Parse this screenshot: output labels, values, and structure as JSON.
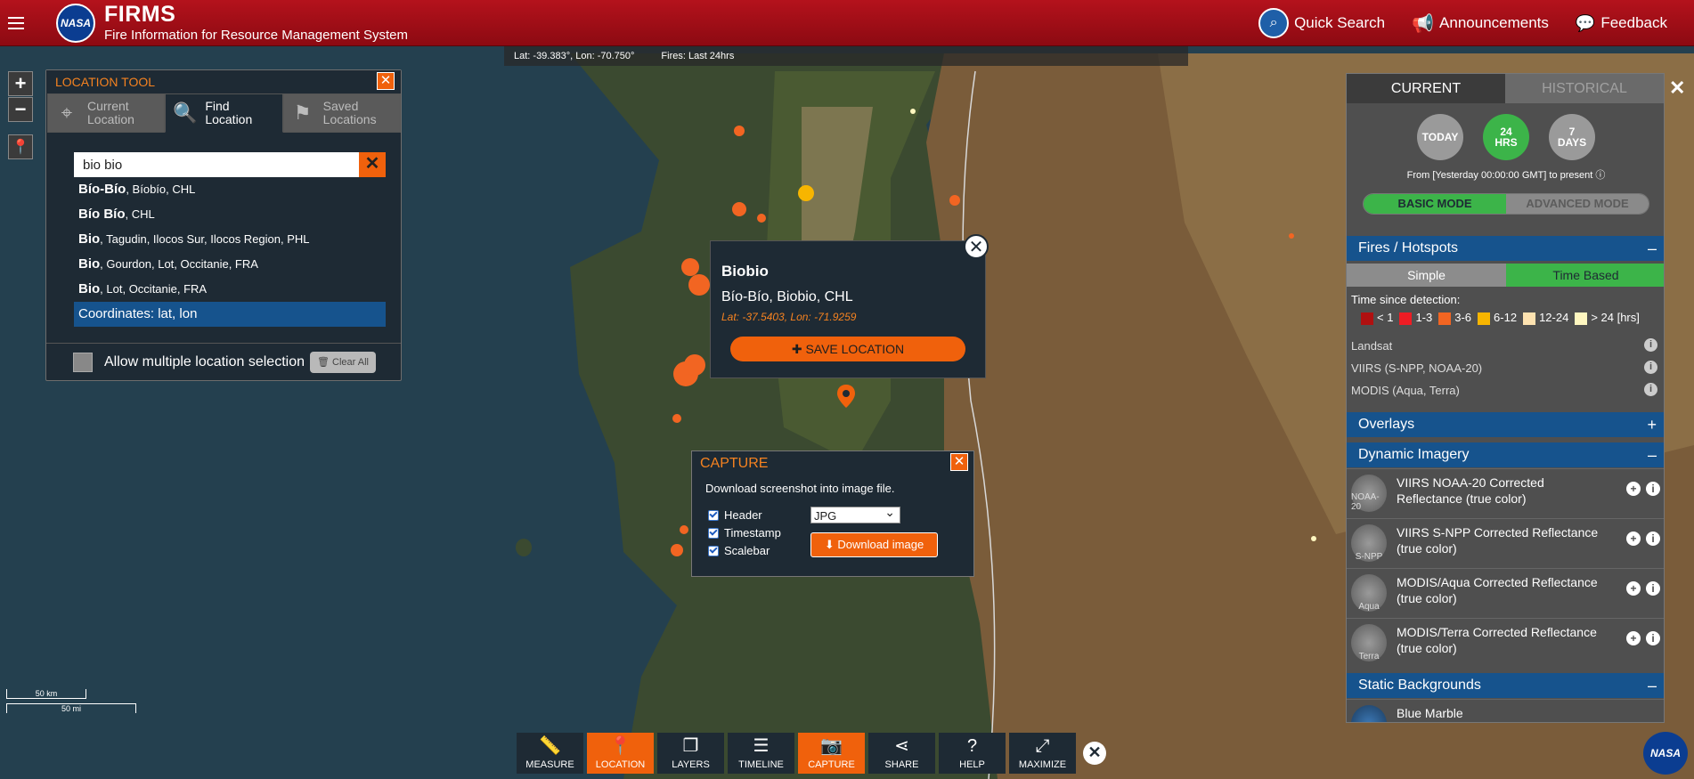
{
  "header": {
    "logo_text": "NASA",
    "app_name": "FIRMS",
    "app_subtitle": "Fire Information for Resource Management System",
    "quick_search": "Quick Search",
    "announcements": "Announcements",
    "feedback": "Feedback"
  },
  "coords_bar": {
    "coords": "Lat: -39.383°, Lon: -70.750°",
    "fires": "Fires: Last 24hrs"
  },
  "map_controls": {
    "zoom_in": "+",
    "zoom_out": "−"
  },
  "location_tool": {
    "title": "LOCATION TOOL",
    "close": "✕",
    "tabs": [
      {
        "line1": "Current",
        "line2": "Location",
        "icon": "crosshair-icon"
      },
      {
        "line1": "Find",
        "line2": "Location",
        "icon": "search-icon"
      },
      {
        "line1": "Saved",
        "line2": "Locations",
        "icon": "flag-icon"
      }
    ],
    "search_value": "bio bio",
    "search_clear": "✕",
    "results": [
      {
        "name": "Bío-Bío",
        "detail": ", Bíobío, CHL"
      },
      {
        "name": "Bío Bío",
        "detail": ", CHL"
      },
      {
        "name": "Bio",
        "detail": ", Tagudin, Ilocos Sur, Ilocos Region, PHL"
      },
      {
        "name": "Bio",
        "detail": ", Gourdon, Lot, Occitanie, FRA"
      },
      {
        "name": "Bio",
        "detail": ", Lot, Occitanie, FRA"
      }
    ],
    "coordinates_item": "Coordinates: lat, lon",
    "allow_multiple": "Allow multiple location selection",
    "clear_all": "Clear All"
  },
  "popup": {
    "title": "Biobio",
    "address": "Bío-Bío, Biobio, CHL",
    "coords": "Lat: -37.5403, Lon: -71.9259",
    "save": "SAVE LOCATION",
    "close": "✕"
  },
  "capture": {
    "title": "CAPTURE",
    "close": "✕",
    "description": "Download screenshot into image file.",
    "options": [
      "Header",
      "Timestamp",
      "Scalebar"
    ],
    "format": "JPG",
    "download": "Download image"
  },
  "right_panel": {
    "tab_current": "CURRENT",
    "tab_historical": "HISTORICAL",
    "close": "✕",
    "today": "TODAY",
    "hrs_num": "24",
    "hrs_label": "HRS",
    "days_num": "7",
    "days_label": "DAYS",
    "range_note": "From [Yesterday 00:00:00 GMT] to present",
    "basic_mode": "BASIC MODE",
    "advanced_mode": "ADVANCED MODE",
    "fires_section": "Fires / Hotspots",
    "simple": "Simple",
    "time_based": "Time Based",
    "legend_title": "Time since detection:",
    "legend": [
      {
        "label": "< 1",
        "color": "#b01010"
      },
      {
        "label": "1-3",
        "color": "#ee1c24"
      },
      {
        "label": "3-6",
        "color": "#f26522"
      },
      {
        "label": "6-12",
        "color": "#f7b500"
      },
      {
        "label": "12-24",
        "color": "#fde2b0"
      },
      {
        "label": "> 24 [hrs]",
        "color": "#fff7c0"
      }
    ],
    "sources": [
      "Landsat",
      "VIIRS (S-NPP, NOAA-20)",
      "MODIS (Aqua, Terra)"
    ],
    "overlays": "Overlays",
    "dynamic_imagery": "Dynamic Imagery",
    "imagery": [
      {
        "label": "VIIRS NOAA-20 Corrected Reflectance (true color)",
        "thumb": "NOAA-20"
      },
      {
        "label": "VIIRS S-NPP Corrected Reflectance (true color)",
        "thumb": "S-NPP"
      },
      {
        "label": "MODIS/Aqua Corrected Reflectance (true color)",
        "thumb": "Aqua"
      },
      {
        "label": "MODIS/Terra Corrected Reflectance (true color)",
        "thumb": "Terra"
      }
    ],
    "static_backgrounds": "Static Backgrounds",
    "blue_marble": "Blue Marble"
  },
  "scale": {
    "km": "50 km",
    "mi": "50 mi"
  },
  "toolbar": {
    "items": [
      {
        "label": "MEASURE",
        "icon": "ruler-icon",
        "active": false
      },
      {
        "label": "LOCATION",
        "icon": "pin-icon",
        "active": true
      },
      {
        "label": "LAYERS",
        "icon": "layers-icon",
        "active": false
      },
      {
        "label": "TIMELINE",
        "icon": "sliders-icon",
        "active": false
      },
      {
        "label": "CAPTURE",
        "icon": "camera-icon",
        "active": true
      },
      {
        "label": "SHARE",
        "icon": "share-icon",
        "active": false
      },
      {
        "label": "HELP",
        "icon": "help-icon",
        "active": false
      },
      {
        "label": "MAXIMIZE",
        "icon": "maximize-icon",
        "active": false
      }
    ],
    "close": "✕"
  },
  "colors": {
    "brand_red": "#a5101a",
    "accent_orange": "#f0610c",
    "panel_blue": "#16538d",
    "active_green": "#3cb449"
  }
}
